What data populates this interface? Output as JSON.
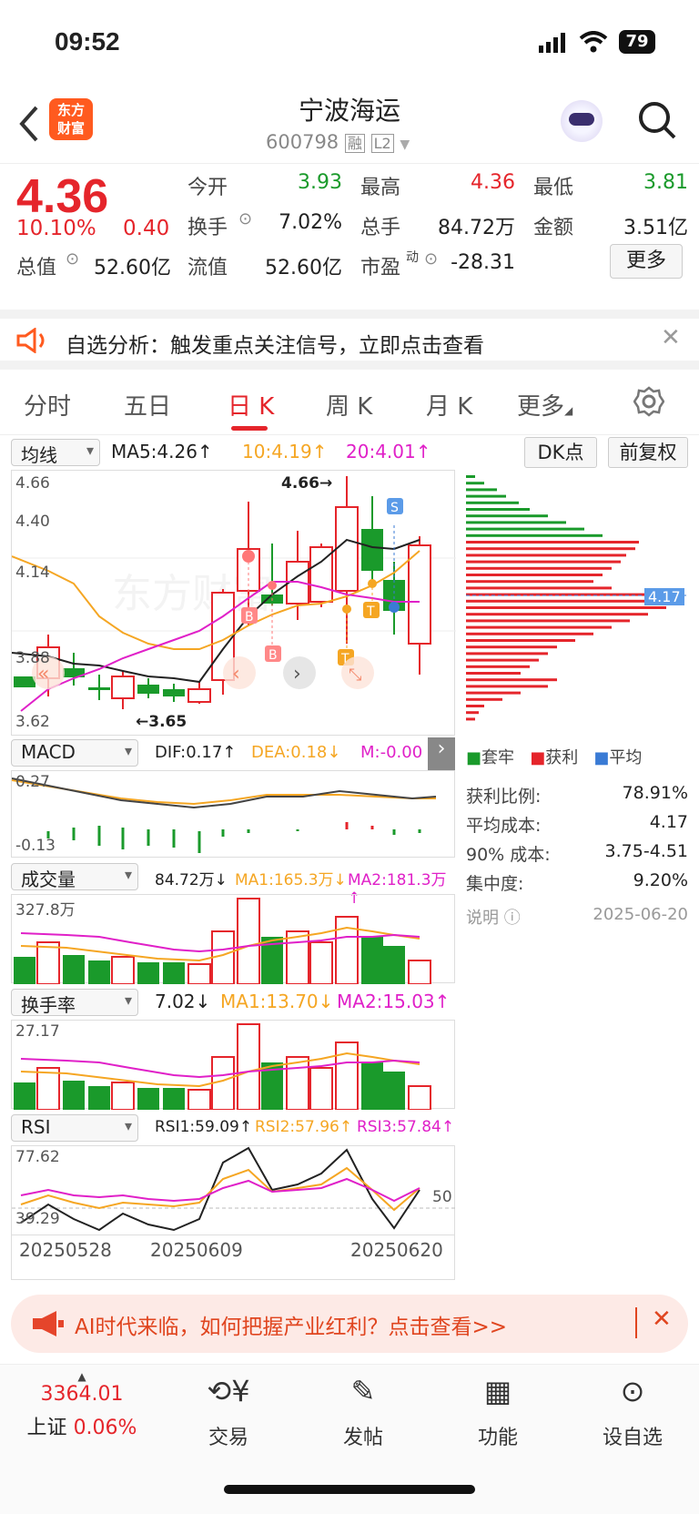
{
  "status": {
    "time": "09:52",
    "battery": "79"
  },
  "nav": {
    "logo_line1": "东方",
    "logo_line2": "财富",
    "stock_name": "宁波海运",
    "stock_code": "600798",
    "badge_rong": "融",
    "badge_l2": "L2"
  },
  "quote": {
    "price": "4.36",
    "change_pct": "10.10%",
    "change": "0.40",
    "open_label": "今开",
    "open": "3.93",
    "high_label": "最高",
    "high": "4.36",
    "low_label": "最低",
    "low": "3.81",
    "turnover_label": "换手",
    "turnover": "7.02%",
    "volume_label": "总手",
    "volume": "84.72万",
    "amount_label": "金额",
    "amount": "3.51亿",
    "mktcap_label": "总值",
    "mktcap": "52.60亿",
    "float_label": "流值",
    "float": "52.60亿",
    "pe_label": "市盈",
    "pe_sup": "动",
    "pe": "-28.31",
    "more": "更多"
  },
  "banner1": {
    "text": "自选分析：触发重点关注信号，立即点击查看"
  },
  "tabs": [
    "分时",
    "五日",
    "日 K",
    "周 K",
    "月 K",
    "更多"
  ],
  "ma_bar": {
    "selector": "均线",
    "ma5": "MA5:4.26↑",
    "ma10": "10:4.19↑",
    "ma20": "20:4.01↑",
    "dk": "DK点",
    "adjust": "前复权"
  },
  "kline": {
    "y_labels": [
      "4.66",
      "4.40",
      "4.14",
      "3.88",
      "3.62"
    ],
    "high_mark": "4.66→",
    "low_mark": "←3.65",
    "watermark": "东方财富"
  },
  "macd": {
    "selector": "MACD",
    "dif": "DIF:0.17↑",
    "dea": "DEA:0.18↓",
    "m": "M:-0.00",
    "y_top": "0.27",
    "y_bottom": "-0.13"
  },
  "vol": {
    "selector": "成交量",
    "value": "84.72万↓",
    "ma1": "MA1:165.3万↓",
    "ma2": "MA2:181.3万↑",
    "y_top": "327.8万"
  },
  "turn": {
    "selector": "换手率",
    "value": "7.02↓",
    "ma1": "MA1:13.70↓",
    "ma2": "MA2:15.03↑",
    "y_top": "27.17"
  },
  "rsi": {
    "selector": "RSI",
    "rsi1": "RSI1:59.09↑",
    "rsi2": "RSI2:57.96↑",
    "rsi3": "RSI3:57.84↑",
    "y_top": "77.62",
    "y_bottom": "39.29",
    "y_mid": "50"
  },
  "dates": [
    "20250528",
    "20250609",
    "20250620"
  ],
  "chips": {
    "legend_trapped": "套牢",
    "legend_profit": "获利",
    "legend_avg": "平均",
    "avg_tag": "4.17",
    "rows": [
      {
        "label": "获利比例:",
        "value": "78.91%"
      },
      {
        "label": "平均成本:",
        "value": "4.17"
      },
      {
        "label": "90% 成本:",
        "value": "3.75-4.51"
      },
      {
        "label": "集中度:",
        "value": "9.20%"
      }
    ],
    "note": "说明",
    "date": "2025-06-20"
  },
  "banner2": {
    "text": "AI时代来临，如何把握产业红利？点击查看>>"
  },
  "bottom": {
    "index_value": "3364.01",
    "index_name": "上证",
    "index_pct": "0.06%",
    "trade": "交易",
    "post": "发帖",
    "func": "功能",
    "watch": "设自选"
  },
  "colors": {
    "red": "#e5252b",
    "green": "#1a9a2b",
    "orange": "#f5a623",
    "magenta": "#e020c8",
    "accent": "#ff5a1f"
  }
}
